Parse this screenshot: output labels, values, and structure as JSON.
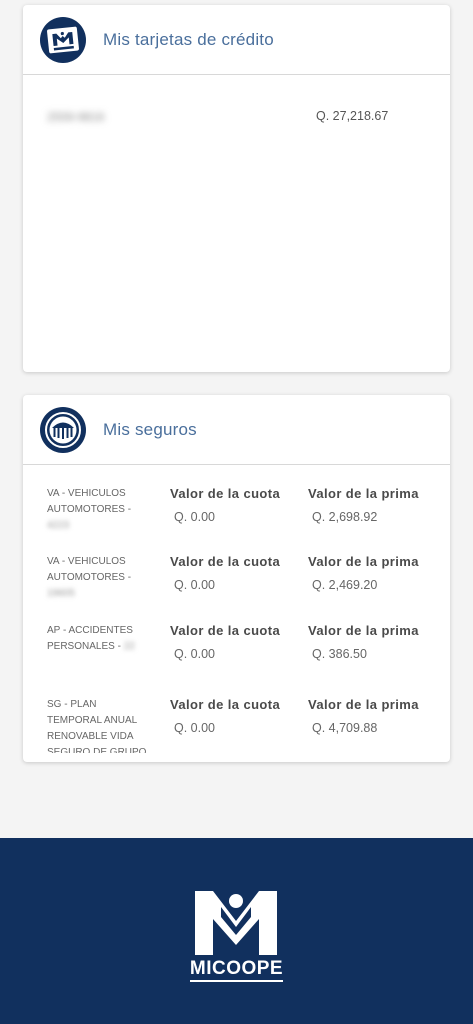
{
  "credit": {
    "title": "Mis tarjetas de crédito",
    "items": [
      {
        "number": "2559-9816",
        "balance": "Q. 27,218.67"
      }
    ]
  },
  "insurance": {
    "title": "Mis seguros",
    "col1_label": "Valor de la cuota",
    "col2_label": "Valor de la prima",
    "items": [
      {
        "name_lines": [
          "VA - VEHICULOS",
          "AUTOMOTORES -"
        ],
        "id": "4223",
        "cuota": "Q. 0.00",
        "prima": "Q. 2,698.92"
      },
      {
        "name_lines": [
          "VA - VEHICULOS",
          "AUTOMOTORES -"
        ],
        "id": "19605",
        "cuota": "Q. 0.00",
        "prima": "Q. 2,469.20"
      },
      {
        "name_lines": [
          "AP - ACCIDENTES",
          "PERSONALES -"
        ],
        "id": "22",
        "cuota": "Q. 0.00",
        "prima": "Q. 386.50"
      },
      {
        "name_lines": [
          "SG - PLAN",
          "TEMPORAL ANUAL",
          "RENOVABLE VIDA",
          "SEGURO DE GRUPO"
        ],
        "id": "",
        "cuota": "Q. 0.00",
        "prima": "Q. 4,709.88"
      }
    ]
  },
  "footer": {
    "logo_text": "MICOOPE"
  },
  "colors": {
    "brand_navy": "#11305e",
    "title_blue": "#4a6f9c"
  },
  "icons": {
    "credit_icon": "micoope-card-icon",
    "insurance_icon": "insurance-umbrella-icon"
  }
}
